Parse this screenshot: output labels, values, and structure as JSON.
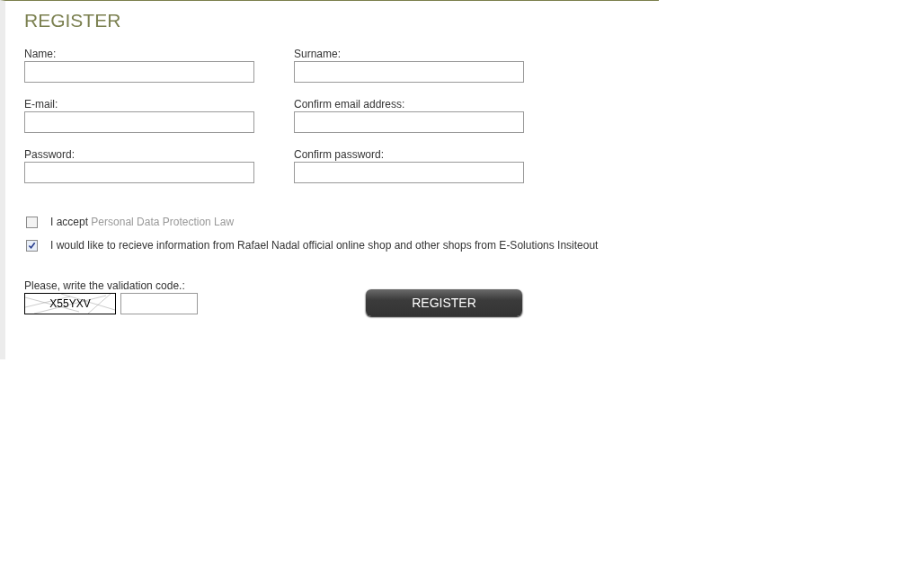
{
  "title": "REGISTER",
  "fields": [
    {
      "label": "Name:"
    },
    {
      "label": "Surname:"
    },
    {
      "label": "E-mail:"
    },
    {
      "label": "Confirm email address:"
    },
    {
      "label": "Password:"
    },
    {
      "label": "Confirm password:"
    }
  ],
  "checkboxes": [
    {
      "text": "I accept ",
      "link": "Personal Data Protection Law",
      "checked": false
    },
    {
      "text": "I would like to recieve information from Rafael Nadal official online shop and other shops from E-Solutions Insiteout",
      "checked": true
    }
  ],
  "validation": {
    "label": "Please, write the validation code.:",
    "code": "X55YXV"
  },
  "register_button": "REGISTER"
}
